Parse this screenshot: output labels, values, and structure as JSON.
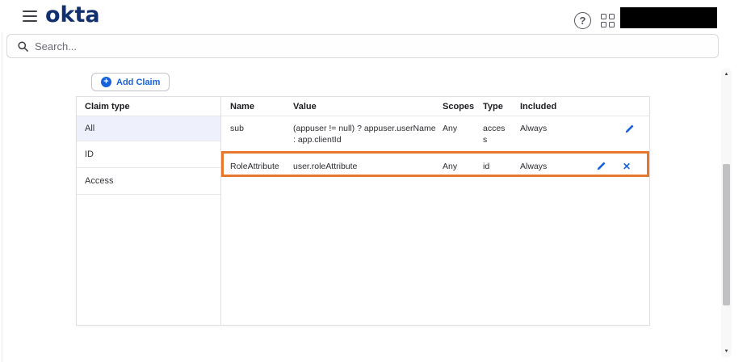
{
  "topbar": {
    "logo_text": "okta",
    "help_label": "?",
    "account_redacted": true
  },
  "search": {
    "placeholder": "Search..."
  },
  "toolbar": {
    "add_claim_label": "Add Claim",
    "plus_glyph": "+"
  },
  "claim_type_panel": {
    "header": "Claim type",
    "items": [
      {
        "label": "All",
        "selected": true
      },
      {
        "label": "ID",
        "selected": false
      },
      {
        "label": "Access",
        "selected": false
      }
    ]
  },
  "claims_table": {
    "columns": {
      "name": "Name",
      "value": "Value",
      "scopes": "Scopes",
      "type": "Type",
      "included": "Included"
    },
    "rows": [
      {
        "name": "sub",
        "value": "(appuser != null) ? appuser.userName : app.clientId",
        "scopes": "Any",
        "type": "access",
        "included": "Always",
        "actions": [
          "edit"
        ],
        "highlighted": false
      },
      {
        "name": "RoleAttribute",
        "value": "user.roleAttribute",
        "scopes": "Any",
        "type": "id",
        "included": "Always",
        "actions": [
          "edit",
          "delete"
        ],
        "highlighted": true
      }
    ],
    "delete_glyph": "✕"
  },
  "scrollbar": {
    "up_glyph": "▲",
    "down_glyph": "▼"
  },
  "colors": {
    "accent_blue": "#1662dd",
    "highlight_orange": "#e8772e",
    "logo_navy": "#12306e",
    "selected_row_bg": "#eef1fb"
  }
}
